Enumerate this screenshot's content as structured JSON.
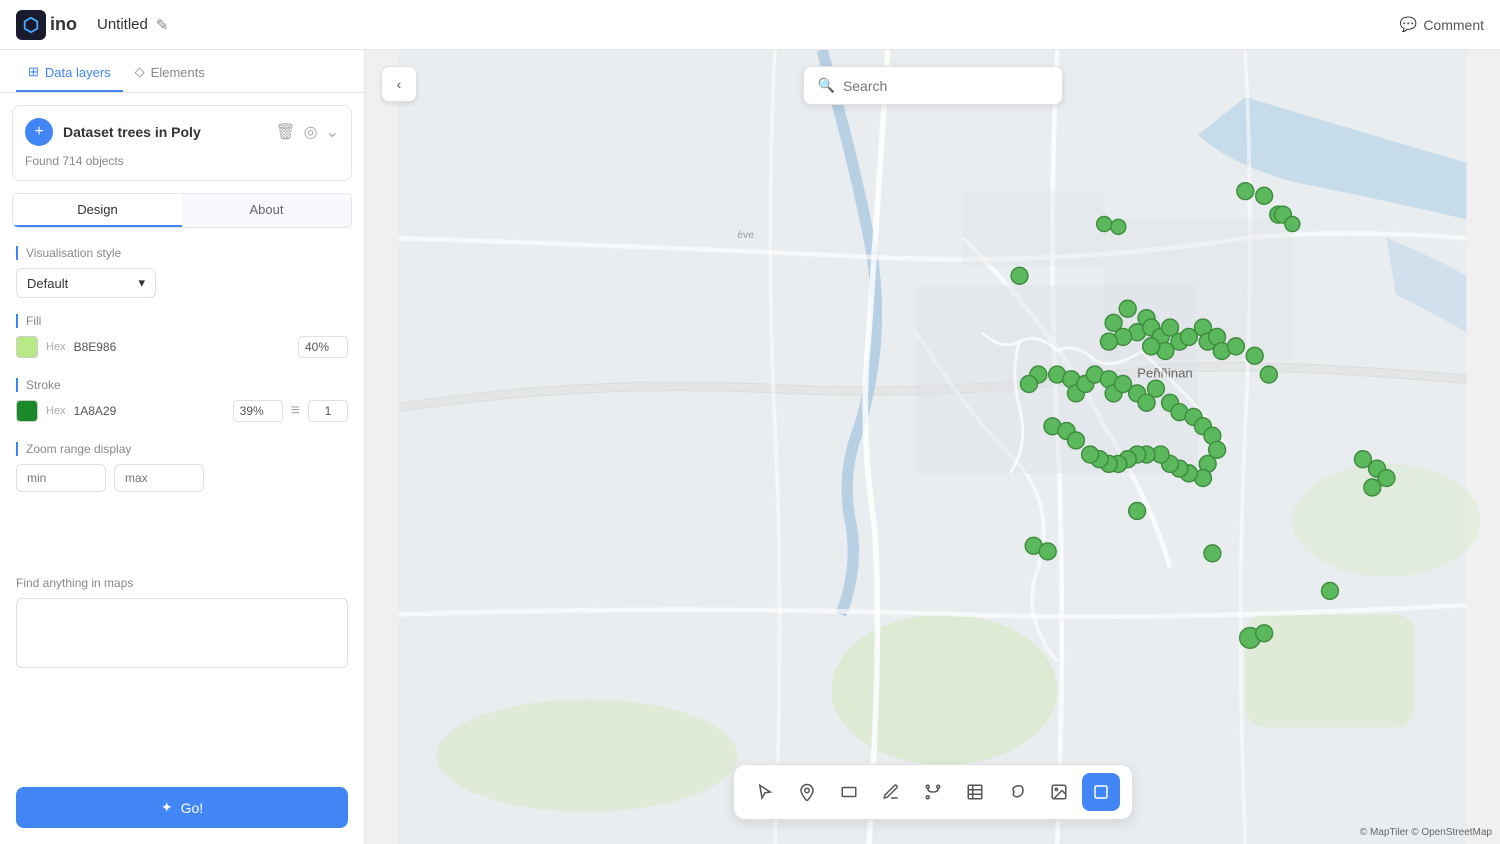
{
  "header": {
    "logo_text": "ino",
    "logo_symbol": "⬡",
    "title": "Untitled",
    "comment_label": "Comment"
  },
  "sidebar": {
    "tab_data_layers": "Data layers",
    "tab_elements": "Elements",
    "dataset_title": "Dataset trees in Poly",
    "found_objects": "Found 714 objects",
    "tab_design": "Design",
    "tab_about": "About",
    "visualisation_style_label": "Visualisation style",
    "viz_default": "Default",
    "fill_label": "Fill",
    "fill_hex_label": "Hex",
    "fill_hex_value": "B8E986",
    "fill_opacity": "40%",
    "stroke_label": "Stroke",
    "stroke_hex_label": "Hex",
    "stroke_hex_value": "1A8A29",
    "stroke_opacity": "39%",
    "stroke_weight": "1",
    "zoom_range_label": "Zoom range display",
    "zoom_min_placeholder": "min",
    "zoom_max_placeholder": "max",
    "search_label": "Find anything in maps",
    "go_button_label": "Go!"
  },
  "map": {
    "search_placeholder": "Search",
    "attribution": "© MapTiler © OpenStreetMap"
  },
  "toolbar": {
    "tools": [
      "cursor",
      "pin",
      "rectangle",
      "pen",
      "path",
      "table",
      "lasso",
      "image",
      "square"
    ]
  },
  "colors": {
    "fill_color": "#B8E986",
    "stroke_color": "#1A8A29",
    "accent": "#4285f4"
  }
}
